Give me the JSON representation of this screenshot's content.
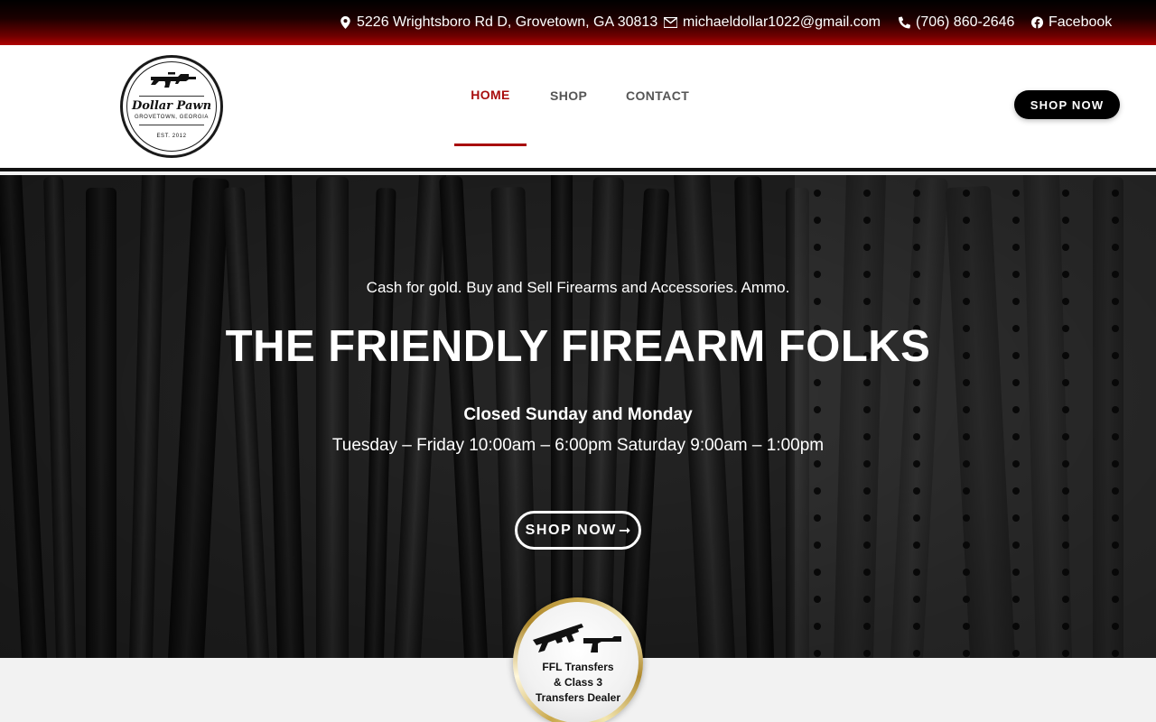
{
  "topbar": {
    "address": "5226 Wrightsboro Rd D, Grovetown, GA 30813",
    "email": "michaeldollar1022@gmail.com",
    "phone": "(706) 860-2646",
    "facebook": "Facebook",
    "icons": [
      "map-marker-icon",
      "envelope-icon",
      "phone-icon",
      "facebook-icon"
    ]
  },
  "header": {
    "logo": {
      "brand": "Dollar Pawn",
      "city": "GROVETOWN, GEORGIA",
      "est": "EST. 2012"
    },
    "nav": [
      {
        "label": "HOME",
        "active": true
      },
      {
        "label": "SHOP",
        "active": false
      },
      {
        "label": "CONTACT",
        "active": false
      }
    ],
    "cta": "SHOP NOW"
  },
  "hero": {
    "tagline": "Cash for gold. Buy and Sell Firearms and Accessories. Ammo.",
    "headline": "THE FRIENDLY FIREARM FOLKS",
    "closed": "Closed Sunday and Monday",
    "hours": "Tuesday – Friday 10:00am – 6:00pm Saturday 9:00am – 1:00pm",
    "button": "SHOP NOW",
    "button_arrow": "➞"
  },
  "badge": {
    "line1": "FFL Transfers",
    "line2": "& Class 3",
    "line3": "Transfers Dealer"
  },
  "colors": {
    "accent": "#a80d0d",
    "topbar_gradient": [
      "#000000",
      "#b00000"
    ],
    "button": "#000000"
  }
}
